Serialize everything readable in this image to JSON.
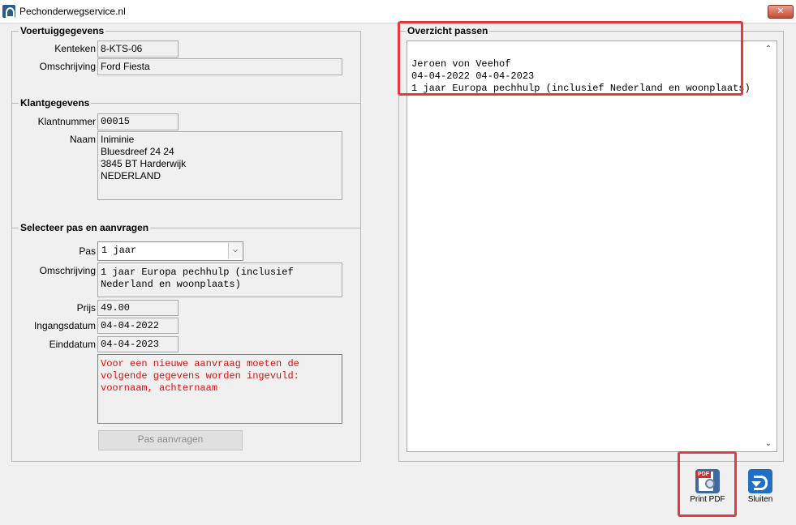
{
  "window": {
    "title": "Pechonderwegservice.nl",
    "close_label": "✕"
  },
  "vehicle": {
    "group_title": "Voertuiggegevens",
    "kenteken_label": "Kenteken",
    "kenteken_value": "8-KTS-06",
    "omschrijving_label": "Omschrijving",
    "omschrijving_value": "Ford Fiesta"
  },
  "client": {
    "group_title": "Klantgegevens",
    "klantnummer_label": "Klantnummer",
    "klantnummer_value": "00015",
    "naam_label": "Naam",
    "naam_value": "Iniminie\nBluesdreef 24 24\n3845 BT  Harderwijk\nNEDERLAND"
  },
  "pass_request": {
    "group_title": "Selecteer pas en aanvragen",
    "pas_label": "Pas",
    "pas_selected": "1 jaar",
    "omschrijving_label": "Omschrijving",
    "omschrijving_value": "1 jaar Europa pechhulp (inclusief\nNederland en woonplaats)",
    "prijs_label": "Prijs",
    "prijs_value": "49.00",
    "ingangsdatum_label": "Ingangsdatum",
    "ingangsdatum_value": "04-04-2022",
    "einddatum_label": "Einddatum",
    "einddatum_value": "04-04-2023",
    "message": "Voor een nieuwe aanvraag moeten de\nvolgende gegevens worden ingevuld:\nvoornaam, achternaam",
    "submit_label": "Pas aanvragen"
  },
  "overview": {
    "group_title": "Overzicht passen",
    "content": "Jeroen von Veehof\n04-04-2022 04-04-2023\n1 jaar Europa pechhulp (inclusief Nederland en woonplaats)"
  },
  "toolbar": {
    "print_pdf_label": "Print PDF",
    "pdf_tag": "PDF",
    "close_label": "Sluiten"
  },
  "colors": {
    "highlight": "#e0393e",
    "error_text": "#e01010"
  }
}
